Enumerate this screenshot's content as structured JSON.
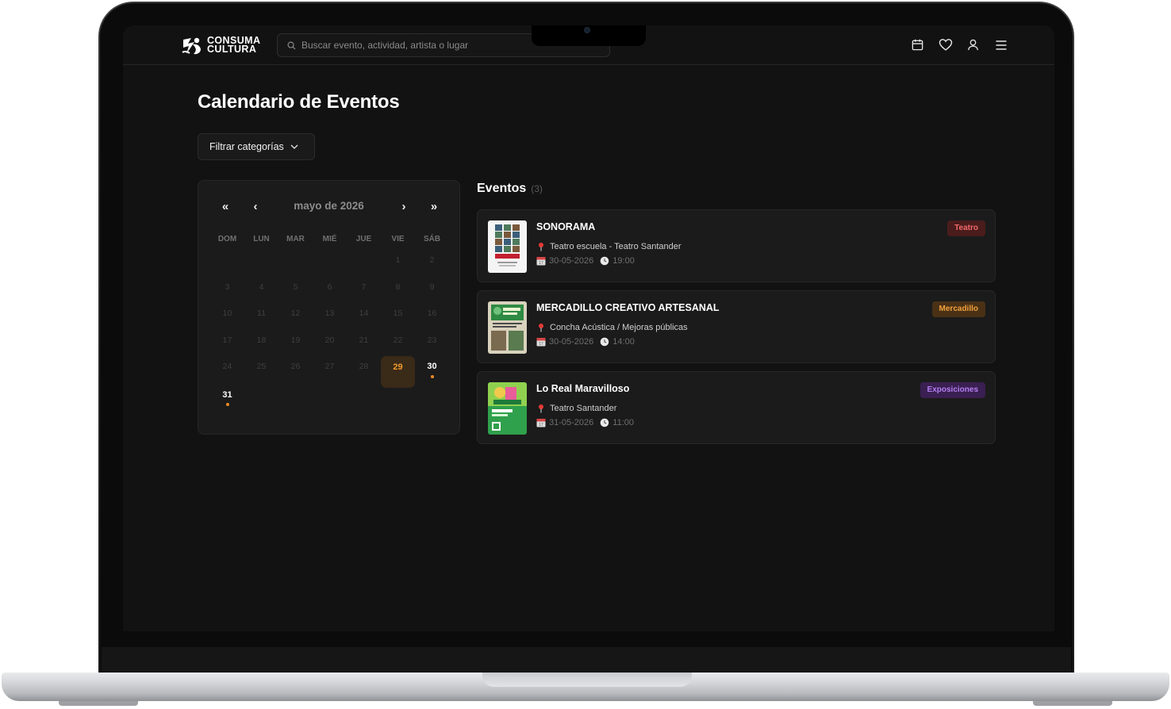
{
  "brand": {
    "line1": "CONSUMA",
    "line2": "CULTURA"
  },
  "search": {
    "placeholder": "Buscar evento, actividad, artista o lugar"
  },
  "nav_icons": [
    "calendar-icon",
    "heart-icon",
    "user-icon",
    "menu-icon"
  ],
  "page": {
    "title": "Calendario de Eventos"
  },
  "filter": {
    "label": "Filtrar categorías"
  },
  "calendar": {
    "month_label": "mayo de 2026",
    "nav": {
      "prev_year": "«",
      "prev_month": "‹",
      "next_month": "›",
      "next_year": "»"
    },
    "weekdays": [
      "DOM",
      "LUN",
      "MAR",
      "MIÉ",
      "JUE",
      "VIE",
      "SÁB"
    ],
    "days": [
      {
        "d": ""
      },
      {
        "d": ""
      },
      {
        "d": ""
      },
      {
        "d": ""
      },
      {
        "d": ""
      },
      {
        "d": "1"
      },
      {
        "d": "2"
      },
      {
        "d": "3"
      },
      {
        "d": "4"
      },
      {
        "d": "5"
      },
      {
        "d": "6"
      },
      {
        "d": "7"
      },
      {
        "d": "8"
      },
      {
        "d": "9"
      },
      {
        "d": "10"
      },
      {
        "d": "11"
      },
      {
        "d": "12"
      },
      {
        "d": "13"
      },
      {
        "d": "14"
      },
      {
        "d": "15"
      },
      {
        "d": "16"
      },
      {
        "d": "17"
      },
      {
        "d": "18"
      },
      {
        "d": "19"
      },
      {
        "d": "20"
      },
      {
        "d": "21"
      },
      {
        "d": "22"
      },
      {
        "d": "23"
      },
      {
        "d": "24"
      },
      {
        "d": "25"
      },
      {
        "d": "26"
      },
      {
        "d": "27"
      },
      {
        "d": "28"
      },
      {
        "d": "29",
        "state": "today"
      },
      {
        "d": "30",
        "state": "event"
      },
      {
        "d": "31",
        "state": "event"
      }
    ]
  },
  "events": {
    "title": "Eventos",
    "count": "(3)",
    "items": [
      {
        "title": "SONORAMA",
        "place": "Teatro escuela - Teatro Santander",
        "date": "30-05-2026",
        "time": "19:00",
        "category": "Teatro",
        "badge_bg": "#4a1c1c",
        "badge_fg": "#f26a6a",
        "thumb": "sonorama-poster"
      },
      {
        "title": "MERCADILLO CREATIVO ARTESANAL",
        "place": "Concha Acústica / Mejoras públicas",
        "date": "30-05-2026",
        "time": "14:00",
        "category": "Mercadillo",
        "badge_bg": "#4a3116",
        "badge_fg": "#f2a13c",
        "thumb": "mercadillo-poster"
      },
      {
        "title": "Lo Real Maravilloso",
        "place": "Teatro Santander",
        "date": "31-05-2026",
        "time": "11:00",
        "category": "Exposiciones",
        "badge_bg": "#3a1f52",
        "badge_fg": "#b47ef0",
        "thumb": "lo-real-maravilloso-poster"
      }
    ]
  },
  "colors": {
    "accent": "#f08a24",
    "background": "#121212",
    "card": "#1b1b1b"
  }
}
